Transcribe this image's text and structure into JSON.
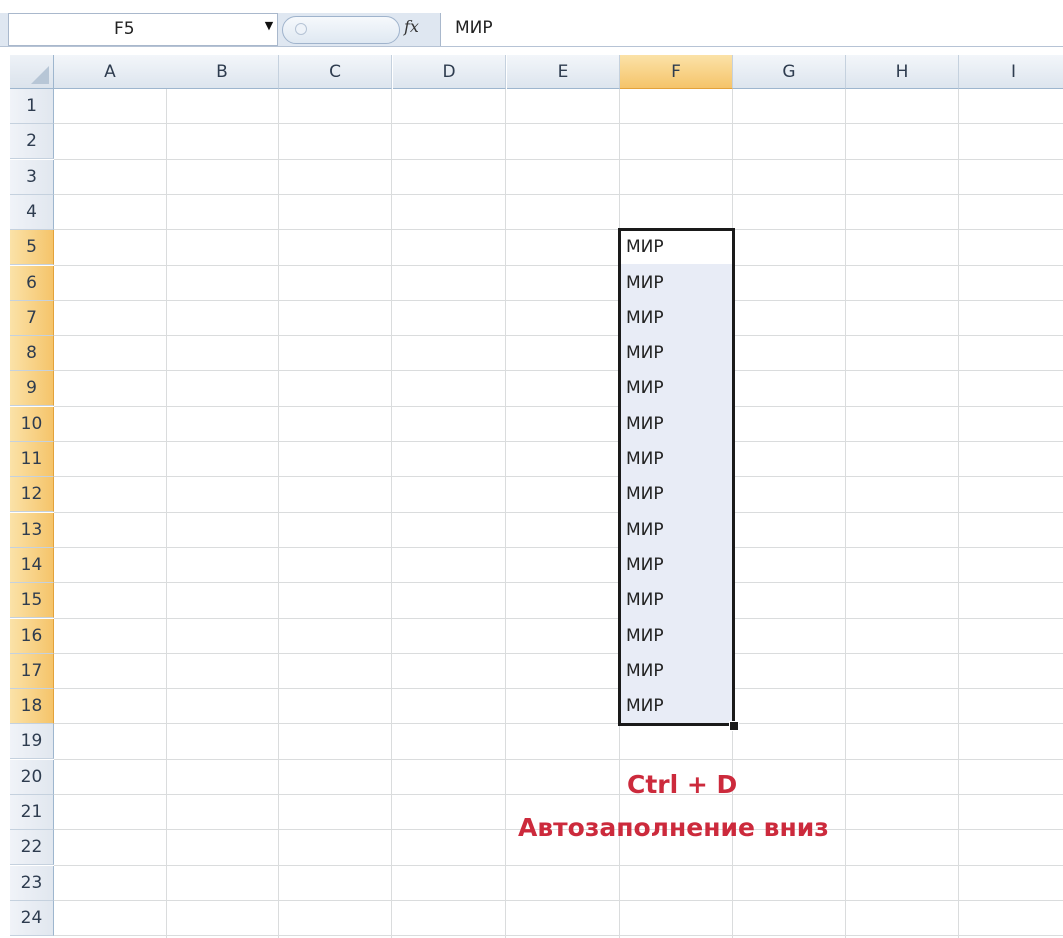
{
  "formula_bar": {
    "name_box": "F5",
    "fx_label": "fx",
    "formula": "МИР"
  },
  "columns": [
    "A",
    "B",
    "C",
    "D",
    "E",
    "F",
    "G",
    "H",
    "I"
  ],
  "rows": [
    "1",
    "2",
    "3",
    "4",
    "5",
    "6",
    "7",
    "8",
    "9",
    "10",
    "11",
    "12",
    "13",
    "14",
    "15",
    "16",
    "17",
    "18",
    "19",
    "20",
    "21",
    "22",
    "23",
    "24"
  ],
  "active_column": "F",
  "selection": {
    "range": "F5:F18",
    "cells": [
      "МИР",
      "МИР",
      "МИР",
      "МИР",
      "МИР",
      "МИР",
      "МИР",
      "МИР",
      "МИР",
      "МИР",
      "МИР",
      "МИР",
      "МИР",
      "МИР"
    ]
  },
  "caption": {
    "shortcut": "Ctrl + D",
    "description": "Автозаполнение вниз",
    "color": "#cc2a3c"
  }
}
